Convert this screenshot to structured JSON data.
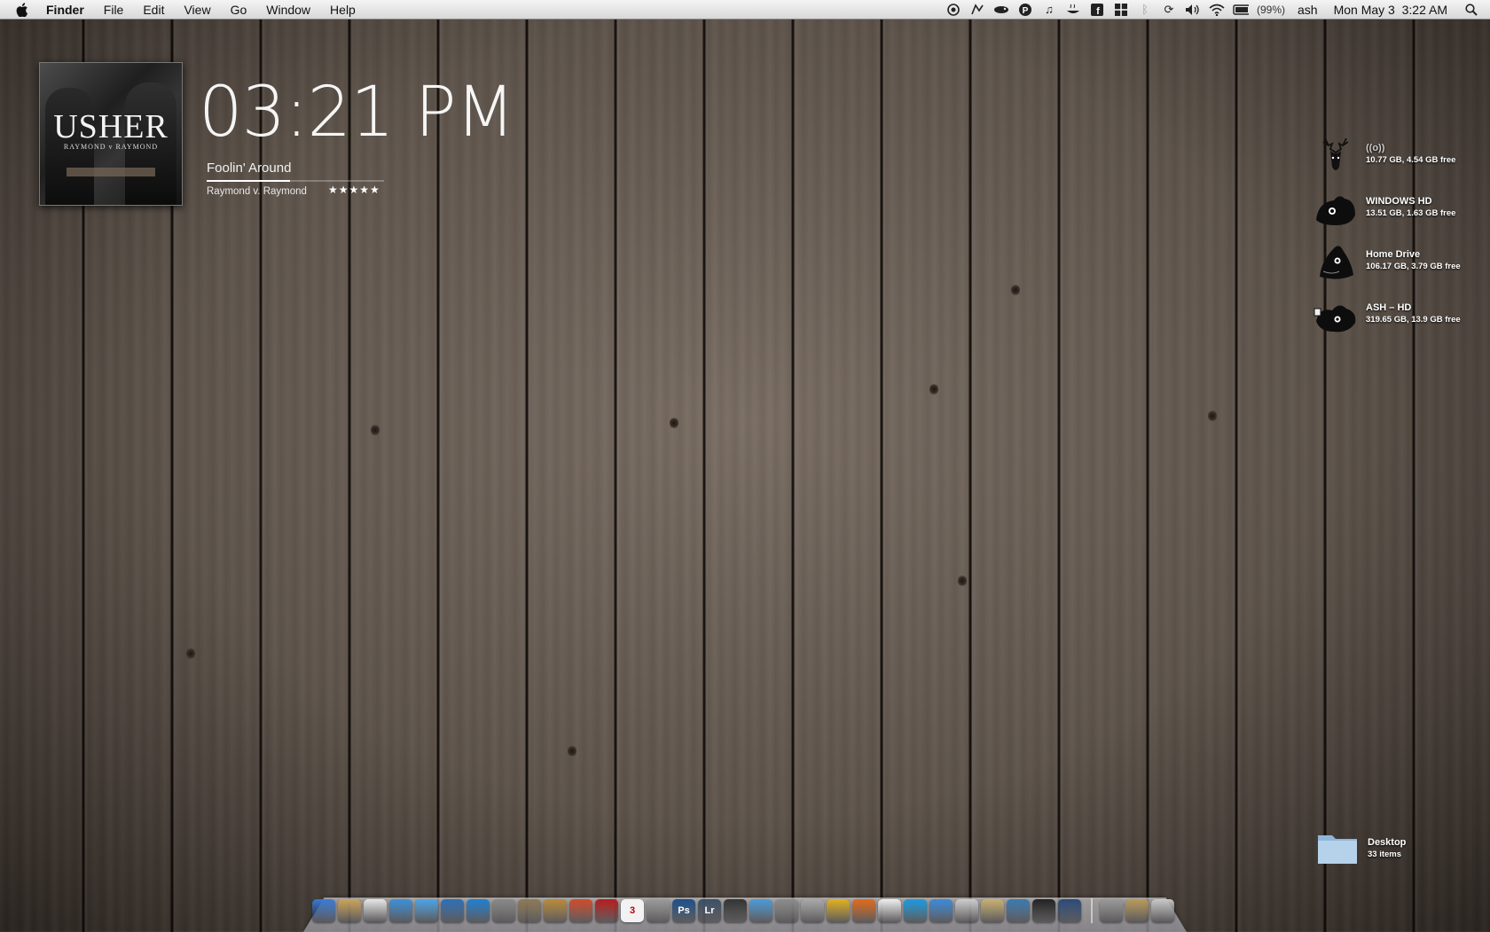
{
  "menubar": {
    "app_name": "Finder",
    "items": [
      "File",
      "Edit",
      "View",
      "Go",
      "Window",
      "Help"
    ],
    "status_icons": [
      "record-icon",
      "script-icon",
      "growl-icon",
      "p-icon",
      "music-note-icon",
      "tea-icon",
      "facebook-icon",
      "grid-icon",
      "bluetooth-icon",
      "sync-icon",
      "volume-icon",
      "wifi-icon",
      "battery-icon"
    ],
    "battery": "(99%)",
    "user": "ash",
    "datetime": "Mon May 3  3:22 AM"
  },
  "now_playing": {
    "album_art_artist": "USHER",
    "album_art_subtitle": "RAYMOND v RAYMOND",
    "time": "03:21 PM",
    "song": "Foolin' Around",
    "album": "Raymond v. Raymond",
    "rating_stars": "★★★★★",
    "progress": 0.47
  },
  "drives": [
    {
      "name": "((o))",
      "info": "10.77 GB, 4.54 GB free",
      "icon": "deer-icon"
    },
    {
      "name": "WINDOWS HD",
      "info": "13.51 GB, 1.63 GB free",
      "icon": "creature-drive-icon"
    },
    {
      "name": "Home Drive",
      "info": "106.17 GB, 3.79 GB free",
      "icon": "creature-drive-icon"
    },
    {
      "name": "ASH – HD",
      "info": "319.65 GB, 13.9 GB free",
      "icon": "creature-drive-icon"
    }
  ],
  "desktop_folder": {
    "name": "Desktop",
    "info": "33 items"
  },
  "dock": {
    "apps": [
      {
        "name": "finder",
        "color": "#3a7bd5",
        "label": ""
      },
      {
        "name": "preview",
        "color": "#c9a35a",
        "label": ""
      },
      {
        "name": "mail",
        "color": "#e6e6e6",
        "label": ""
      },
      {
        "name": "safari",
        "color": "#3b8fd8",
        "label": ""
      },
      {
        "name": "itunes",
        "color": "#4aa3e8",
        "label": ""
      },
      {
        "name": "quicktime",
        "color": "#2d6fb8",
        "label": ""
      },
      {
        "name": "dvd-player",
        "color": "#1e7fd0",
        "label": ""
      },
      {
        "name": "imovie",
        "color": "#888888",
        "label": ""
      },
      {
        "name": "iphoto",
        "color": "#8d7a55",
        "label": ""
      },
      {
        "name": "garageband",
        "color": "#b88a3a",
        "label": ""
      },
      {
        "name": "photo-booth",
        "color": "#d04a2a",
        "label": ""
      },
      {
        "name": "address-book",
        "color": "#b81c1c",
        "label": ""
      },
      {
        "name": "ical",
        "color": "#f2f2f2",
        "label": "3"
      },
      {
        "name": "system-preferences",
        "color": "#9a9a9a",
        "label": ""
      },
      {
        "name": "photoshop",
        "color": "#1a4f8a",
        "label": "Ps"
      },
      {
        "name": "lightroom",
        "color": "#3a4f66",
        "label": "Lr"
      },
      {
        "name": "aperture",
        "color": "#333333",
        "label": ""
      },
      {
        "name": "omnigraffle",
        "color": "#4a9ad8",
        "label": ""
      },
      {
        "name": "utility",
        "color": "#8c8c8c",
        "label": ""
      },
      {
        "name": "automator",
        "color": "#a8a8a8",
        "label": ""
      },
      {
        "name": "console",
        "color": "#e0b020",
        "label": ""
      },
      {
        "name": "firefox",
        "color": "#e06a1a",
        "label": ""
      },
      {
        "name": "messages",
        "color": "#eeeeee",
        "label": ""
      },
      {
        "name": "skype",
        "color": "#1a9ae0",
        "label": ""
      },
      {
        "name": "ichat",
        "color": "#3a8ad8",
        "label": ""
      },
      {
        "name": "calculator",
        "color": "#cccccc",
        "label": ""
      },
      {
        "name": "textedit",
        "color": "#c8b070",
        "label": ""
      },
      {
        "name": "network",
        "color": "#3a7ab0",
        "label": ""
      },
      {
        "name": "plex",
        "color": "#222222",
        "label": ""
      },
      {
        "name": "time-machine",
        "color": "#2a4a7a",
        "label": ""
      }
    ],
    "stacks": [
      {
        "name": "documents-stack",
        "color": "#999999"
      },
      {
        "name": "downloads-stack",
        "color": "#b89a5a"
      },
      {
        "name": "trash",
        "color": "#c8c8c8"
      }
    ]
  }
}
